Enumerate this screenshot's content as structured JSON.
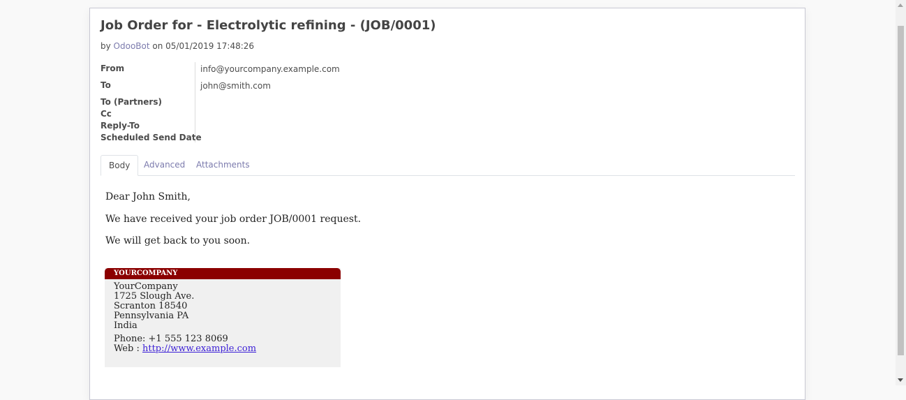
{
  "message": {
    "title": "Job Order for - Electrolytic refining - (JOB/0001)",
    "by_prefix": "by",
    "author": "OdooBot",
    "on_text": "on 05/01/2019 17:48:26"
  },
  "fields": {
    "from_label": "From",
    "from_value": "info@yourcompany.example.com",
    "to_label": "To",
    "to_value": "john@smith.com",
    "to_partners_label": "To (Partners)",
    "cc_label": "Cc",
    "reply_to_label": "Reply-To",
    "scheduled_label": "Scheduled Send Date"
  },
  "tabs": [
    {
      "label": "Body",
      "active": true
    },
    {
      "label": "Advanced",
      "active": false
    },
    {
      "label": "Attachments",
      "active": false
    }
  ],
  "body": {
    "greeting": "Dear John Smith,",
    "line1": "We have received your job order JOB/0001 request.",
    "line2": "We will get back to you soon."
  },
  "signature": {
    "header": "YOURCOMPANY",
    "company": "YourCompany",
    "street": "1725 Slough Ave.",
    "city": "Scranton 18540",
    "state": "Pennsylvania PA",
    "country": "India",
    "phone": "Phone:  +1 555 123 8069",
    "web_prefix": "Web : ",
    "web_link": "http://www.example.com"
  },
  "colors": {
    "link": "#7c7bad",
    "signature_header": "#8b0000",
    "signature_bg": "#f0f0f0"
  }
}
